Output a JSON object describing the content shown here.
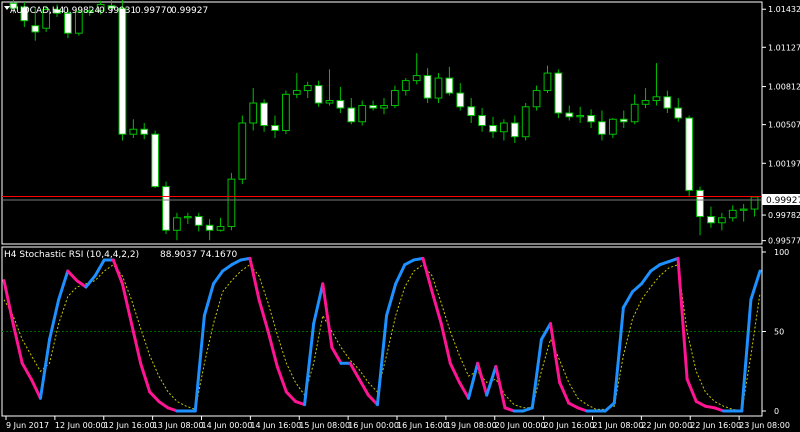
{
  "price_header": {
    "symbol": "AUDCAD,H4",
    "open": "0.99824",
    "high": "0.99931",
    "low": "0.99770",
    "close": "0.99927"
  },
  "indicator_header": {
    "name": "H4 Stochastic RSI (10,4,4,2,2)",
    "value1": "88.9037",
    "value2": "74.1670"
  },
  "current_price_label": "0.99927",
  "colors": {
    "background": "#000000",
    "bull_candle": "#00c000",
    "bear_candle": "#ffffff",
    "ask_line": "#ff0000",
    "bid_line": "#7a7a7a",
    "stoch_up": "#1e90ff",
    "stoch_down": "#ff1493",
    "signal": "#c8c800",
    "level_line": "#006400",
    "axis": "#ffffff"
  },
  "chart_data": [
    {
      "type": "candlestick",
      "title": "AUDCAD,H4",
      "yticks": [
        "1.01432",
        "1.01127",
        "1.00812",
        "1.00507",
        "1.00197",
        "0.99887",
        "0.99782",
        "0.99577"
      ],
      "ylim": [
        0.9955,
        1.0149
      ],
      "xticks": [
        "9 Jun 2017",
        "12 Jun 00:00",
        "12 Jun 16:00",
        "13 Jun 08:00",
        "14 Jun 00:00",
        "14 Jun 16:00",
        "15 Jun 08:00",
        "16 Jun 00:00",
        "16 Jun 16:00",
        "19 Jun 08:00",
        "20 Jun 00:00",
        "20 Jun 16:00",
        "21 Jun 08:00",
        "22 Jun 00:00",
        "22 Jun 16:00",
        "23 Jun 08:00"
      ],
      "ask_price": 0.99931,
      "bid_price": 0.99927,
      "candles": [
        [
          1.0148,
          1.0152,
          1.014,
          1.0144
        ],
        [
          1.0145,
          1.0149,
          1.0129,
          1.0134
        ],
        [
          1.013,
          1.0145,
          1.0118,
          1.0125
        ],
        [
          1.0128,
          1.0146,
          1.0125,
          1.0143
        ],
        [
          1.0143,
          1.0147,
          1.0137,
          1.014
        ],
        [
          1.014,
          1.0143,
          1.012,
          1.0124
        ],
        [
          1.0124,
          1.0145,
          1.0122,
          1.0141
        ],
        [
          1.0141,
          1.0146,
          1.0138,
          1.0142
        ],
        [
          1.0142,
          1.015,
          1.0139,
          1.0147
        ],
        [
          1.0146,
          1.0152,
          1.014,
          1.0144
        ],
        [
          1.0144,
          1.0152,
          1.0038,
          1.0043
        ],
        [
          1.0043,
          1.0055,
          1.004,
          1.0047
        ],
        [
          1.0047,
          1.0052,
          1.0039,
          1.0043
        ],
        [
          1.0043,
          1.0046,
          1.0,
          1.0001
        ],
        [
          1.0001,
          1.0005,
          0.9963,
          0.9966
        ],
        [
          0.9966,
          0.998,
          0.9958,
          0.9976
        ],
        [
          0.9976,
          0.998,
          0.9971,
          0.9977
        ],
        [
          0.9977,
          0.998,
          0.9965,
          0.997
        ],
        [
          0.997,
          0.9975,
          0.9958,
          0.9966
        ],
        [
          0.9966,
          0.9976,
          0.9965,
          0.9969
        ],
        [
          0.9969,
          1.0012,
          0.9966,
          1.0007
        ],
        [
          1.0007,
          1.0058,
          1.0003,
          1.0052
        ],
        [
          1.0052,
          1.008,
          1.0046,
          1.0068
        ],
        [
          1.0068,
          1.0071,
          1.0045,
          1.005
        ],
        [
          1.005,
          1.0058,
          1.004,
          1.0046
        ],
        [
          1.0046,
          1.0078,
          1.0043,
          1.0075
        ],
        [
          1.0075,
          1.0092,
          1.0072,
          1.0078
        ],
        [
          1.0078,
          1.0085,
          1.0072,
          1.0082
        ],
        [
          1.0082,
          1.0086,
          1.0065,
          1.0068
        ],
        [
          1.0068,
          1.0095,
          1.0066,
          1.007
        ],
        [
          1.007,
          1.0081,
          1.006,
          1.0064
        ],
        [
          1.0064,
          1.0072,
          1.0051,
          1.0053
        ],
        [
          1.0053,
          1.007,
          1.005,
          1.0066
        ],
        [
          1.0066,
          1.007,
          1.0062,
          1.0064
        ],
        [
          1.0064,
          1.0072,
          1.0059,
          1.0066
        ],
        [
          1.0066,
          1.0082,
          1.0064,
          1.0078
        ],
        [
          1.0078,
          1.0088,
          1.0074,
          1.0086
        ],
        [
          1.0086,
          1.0108,
          1.0083,
          1.009
        ],
        [
          1.009,
          1.0096,
          1.0068,
          1.0072
        ],
        [
          1.0072,
          1.0092,
          1.0068,
          1.0088
        ],
        [
          1.0088,
          1.0097,
          1.0074,
          1.0076
        ],
        [
          1.0076,
          1.0084,
          1.0062,
          1.0065
        ],
        [
          1.0065,
          1.0072,
          1.0052,
          1.0058
        ],
        [
          1.0058,
          1.0064,
          1.0045,
          1.005
        ],
        [
          1.005,
          1.0057,
          1.004,
          1.0045
        ],
        [
          1.0045,
          1.0055,
          1.0038,
          1.0052
        ],
        [
          1.0052,
          1.0058,
          1.0036,
          1.0041
        ],
        [
          1.0041,
          1.0068,
          1.0038,
          1.0065
        ],
        [
          1.0065,
          1.0082,
          1.0062,
          1.0078
        ],
        [
          1.0078,
          1.0098,
          1.0076,
          1.0092
        ],
        [
          1.0092,
          1.0095,
          1.0056,
          1.006
        ],
        [
          1.006,
          1.0066,
          1.0054,
          1.0057
        ],
        [
          1.0057,
          1.0065,
          1.0052,
          1.0058
        ],
        [
          1.0058,
          1.0063,
          1.0048,
          1.0053
        ],
        [
          1.0053,
          1.0062,
          1.0038,
          1.0043
        ],
        [
          1.0043,
          1.0056,
          1.004,
          1.0055
        ],
        [
          1.0055,
          1.0062,
          1.0048,
          1.0053
        ],
        [
          1.0053,
          1.0075,
          1.0051,
          1.0067
        ],
        [
          1.0067,
          1.008,
          1.0064,
          1.007
        ],
        [
          1.007,
          1.01,
          1.0066,
          1.0073
        ],
        [
          1.0073,
          1.0078,
          1.006,
          1.0064
        ],
        [
          1.0064,
          1.0072,
          1.0053,
          1.0056
        ],
        [
          1.0056,
          1.0058,
          0.9993,
          0.9998
        ],
        [
          0.9998,
          1.0001,
          0.9962,
          0.9977
        ],
        [
          0.9977,
          0.9985,
          0.9968,
          0.9972
        ],
        [
          0.9972,
          0.998,
          0.9966,
          0.9976
        ],
        [
          0.9976,
          0.9986,
          0.9973,
          0.9982
        ],
        [
          0.9982,
          0.9987,
          0.9973,
          0.9983
        ],
        [
          0.9983,
          0.9993,
          0.9977,
          0.99927
        ]
      ]
    },
    {
      "type": "line",
      "title": "H4 Stochastic RSI (10,4,4,2,2)",
      "ylim": [
        0,
        100
      ],
      "yticks": [
        "100",
        "50",
        "0"
      ],
      "level": 50,
      "series": [
        {
          "name": "88.9037",
          "values": [
            82,
            55,
            30,
            20,
            8,
            45,
            70,
            88,
            82,
            78,
            85,
            95,
            95,
            80,
            55,
            30,
            12,
            6,
            2,
            0,
            0,
            0,
            60,
            80,
            88,
            92,
            95,
            96,
            70,
            50,
            28,
            12,
            6,
            4,
            55,
            80,
            40,
            30,
            30,
            20,
            10,
            4,
            60,
            80,
            92,
            95,
            96,
            75,
            55,
            30,
            18,
            8,
            30,
            10,
            28,
            2,
            0,
            0,
            2,
            45,
            55,
            18,
            5,
            2,
            0,
            0,
            0,
            5,
            65,
            75,
            80,
            88,
            92,
            94,
            96,
            20,
            6,
            3,
            2,
            0,
            0,
            0,
            70,
            88
          ]
        },
        {
          "name": "74.1670",
          "values": [
            70,
            60,
            45,
            35,
            25,
            30,
            55,
            72,
            78,
            80,
            82,
            88,
            92,
            85,
            70,
            52,
            35,
            22,
            12,
            6,
            3,
            1,
            30,
            55,
            75,
            82,
            88,
            92,
            85,
            68,
            48,
            30,
            18,
            10,
            30,
            60,
            50,
            40,
            32,
            26,
            18,
            12,
            35,
            60,
            78,
            88,
            92,
            85,
            68,
            50,
            35,
            22,
            25,
            18,
            20,
            10,
            4,
            2,
            2,
            25,
            45,
            32,
            18,
            8,
            4,
            1,
            1,
            3,
            35,
            58,
            70,
            78,
            85,
            90,
            92,
            50,
            25,
            12,
            6,
            3,
            1,
            0,
            35,
            74
          ]
        }
      ]
    }
  ]
}
